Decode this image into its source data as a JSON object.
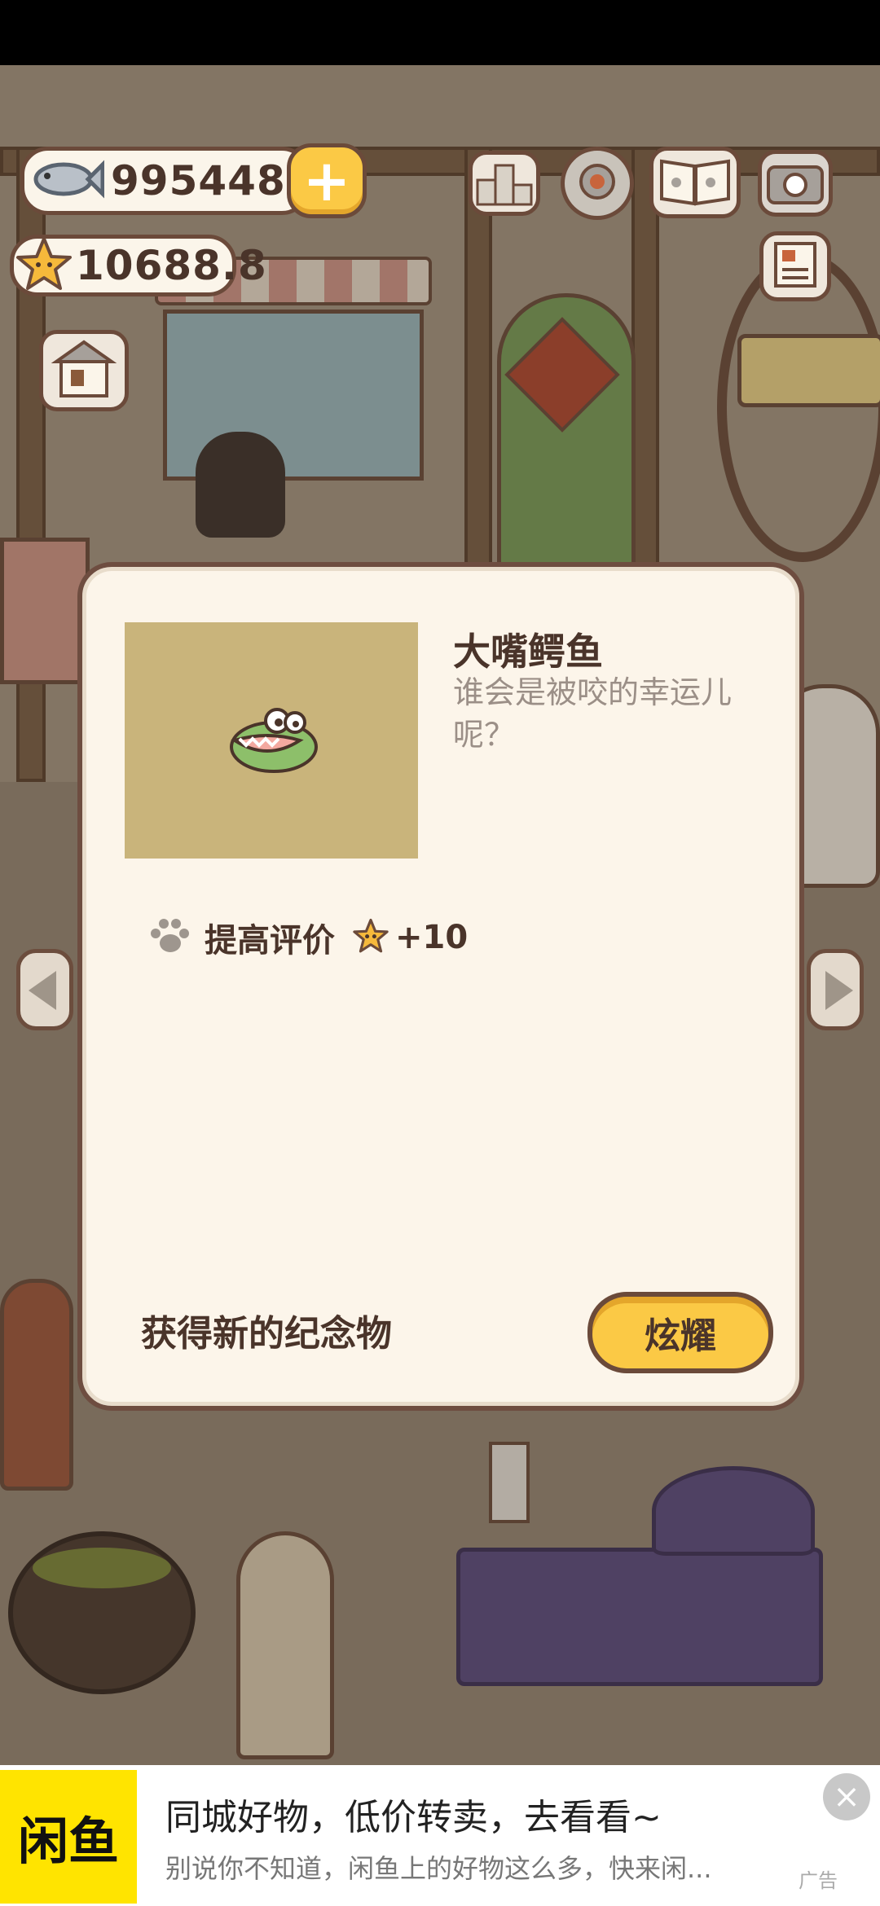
{
  "hud": {
    "fish_count": "995448",
    "star_count": "10688.8",
    "add_label": "+"
  },
  "modal": {
    "item_title": "大嘴鳄鱼",
    "item_description": "谁会是被咬的幸运儿呢？",
    "reward_label": "提高评价",
    "reward_value": "+10",
    "footer_text": "获得新的纪念物",
    "show_off_button": "炫耀"
  },
  "ad": {
    "logo_text": "闲鱼",
    "title": "同城好物，低价转卖，去看看~",
    "subtitle": "别说你不知道，闲鱼上的好物这么多，快来闲...",
    "badge": "广告",
    "close_symbol": "×"
  },
  "icons": [
    "fish-icon",
    "star-icon",
    "plus-icon",
    "leaderboard-icon",
    "settings-gear-icon",
    "cat-book-icon",
    "camera-icon",
    "shop-icon",
    "newspaper-icon",
    "paw-icon",
    "left-arrow-icon",
    "right-arrow-icon",
    "crocodile-icon",
    "close-icon"
  ],
  "colors": {
    "accent_yellow": "#fbc945",
    "outline_brown": "#6b4a3a",
    "modal_bg": "#fcf5ea",
    "thumb_bg": "#c9b47b",
    "ad_logo_yellow": "#ffe400"
  }
}
